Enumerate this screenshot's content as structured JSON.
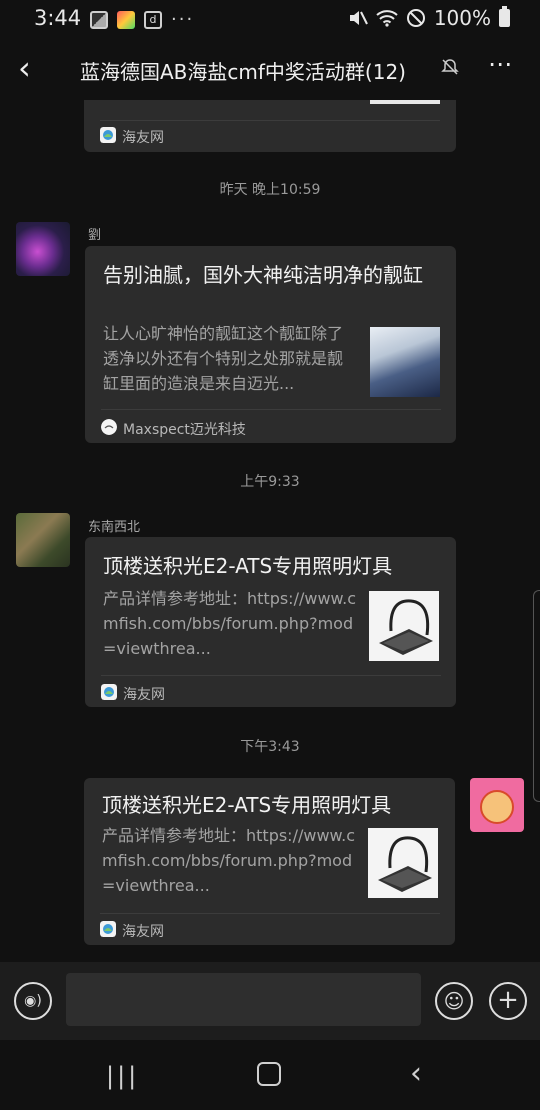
{
  "status_bar": {
    "time": "3:44",
    "battery": "100%",
    "icons": [
      "photo-icon",
      "app-icon",
      "tiktok-icon",
      "more-dots-icon",
      "mute-icon",
      "wifi-icon",
      "dnd-icon",
      "battery-icon"
    ]
  },
  "header": {
    "back_icon": "‹",
    "title": "蓝海德国AB海盐cmf中奖活动群(12)",
    "more_icon": "⋯"
  },
  "messages": [
    {
      "kind": "partial-card",
      "source": "海友网"
    },
    {
      "kind": "timestamp",
      "text": "昨天 晚上10:59"
    },
    {
      "kind": "card",
      "sender": "劉",
      "title": "告别油腻，国外大神纯洁明净的靓缸",
      "desc": "让人心旷神怡的靓缸这个靓缸除了透净以外还有个特别之处那就是靓缸里面的造浪是来自迈光...",
      "source": "Maxspect迈光科技"
    },
    {
      "kind": "timestamp",
      "text": "上午9:33"
    },
    {
      "kind": "card",
      "sender": "东南西北",
      "title": "顶楼送积光E2-ATS专用照明灯具",
      "desc": "产品详情参考地址：https://www.cmfish.com/bbs/forum.php?mod=viewthrea...",
      "source": "海友网"
    },
    {
      "kind": "timestamp",
      "text": "下午3:43"
    },
    {
      "kind": "card-self",
      "title": "顶楼送积光E2-ATS专用照明灯具",
      "desc": "产品详情参考地址：https://www.cmfish.com/bbs/forum.php?mod=viewthrea...",
      "source": "海友网"
    }
  ],
  "input_bar": {
    "voice_icon": "voice-icon",
    "emoji_icon": "emoji-icon",
    "plus_icon": "plus-icon"
  },
  "nav_bar": {
    "icons": [
      "recent-apps-icon",
      "home-icon",
      "back-icon"
    ]
  },
  "colors": {
    "background": "#111111",
    "bubble": "#2c2c2c",
    "secondary_text": "#a3a3a3"
  }
}
